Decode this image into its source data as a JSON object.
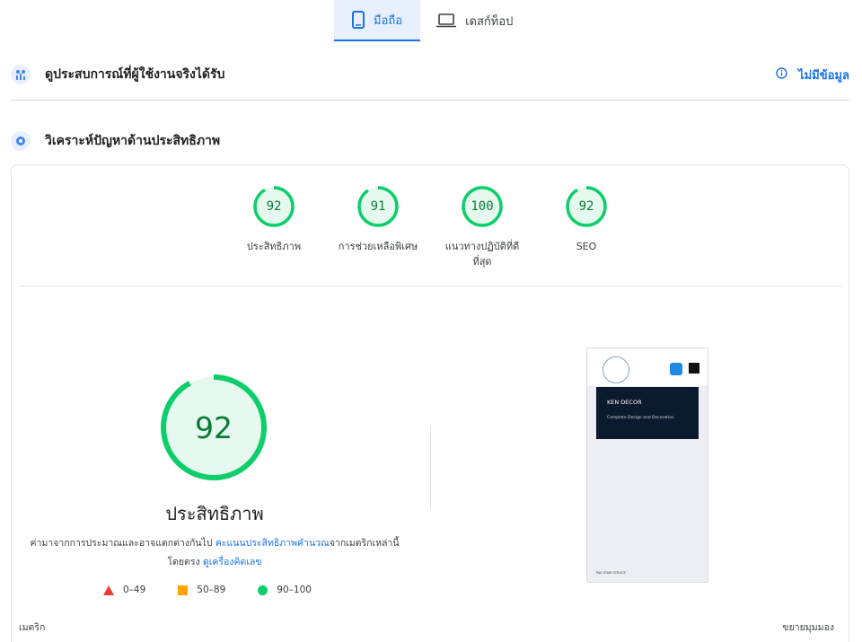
{
  "tabs": [
    {
      "label": "มือถือ",
      "icon": "smartphone-icon",
      "active": true
    },
    {
      "label": "เดสก์ท็อป",
      "icon": "laptop-icon",
      "active": false
    }
  ],
  "crux": {
    "title": "ดูประสบการณ์ที่ผู้ใช้งานจริงได้รับ",
    "status": "ไม่มีข้อมูล"
  },
  "diagnose": {
    "title": "วิเคราะห์ปัญหาด้านประสิทธิภาพ"
  },
  "categories": [
    {
      "score": "92",
      "label": "ประสิทธิภาพ"
    },
    {
      "score": "91",
      "label": "การช่วยเหลือพิเศษ"
    },
    {
      "score": "100",
      "label": "แนวทางปฏิบัติที่ดีที่สุด"
    },
    {
      "score": "92",
      "label": "SEO"
    }
  ],
  "performance": {
    "score": "92",
    "title": "ประสิทธิภาพ",
    "note_prefix": "ค่ามาจากการประมาณและอาจแตกต่างกันไป ",
    "note_link1": "คะแนนประสิทธิภาพคำนวณ",
    "note_mid": "จากเมตริกเหล่านี้โดยตรง ",
    "note_link2": "ดูเครื่องคิดเลข"
  },
  "legend": [
    {
      "range": "0–49",
      "color": "#eb3a34"
    },
    {
      "range": "50–89",
      "color": "#ffa400"
    },
    {
      "range": "90–100",
      "color": "#0cce6b"
    }
  ],
  "footer": {
    "metrics_label": "เมตริก",
    "expand_label": "ขยายมุมมอง"
  },
  "thumbnail": {
    "hero_title": "KEN DECOR",
    "hero_subtitle": "Complete Design and Decoration",
    "bottom_text": "PAS STAIR STRUCE"
  },
  "colors": {
    "accent": "#1a73e8",
    "pass": "#0cce6b",
    "pass_text": "#0a7a39"
  }
}
